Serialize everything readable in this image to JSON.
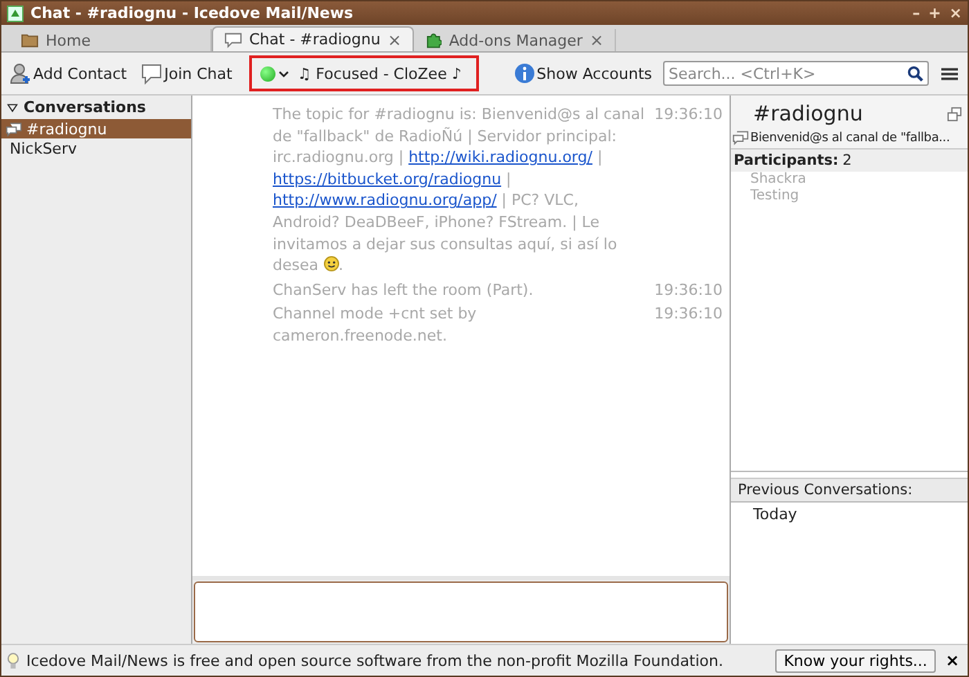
{
  "window": {
    "title": "Chat - #radiognu - Icedove Mail/News",
    "controls": [
      "–",
      "+",
      "×"
    ]
  },
  "tabs": [
    {
      "label": "Home",
      "kind": "folder",
      "selected": false
    },
    {
      "label": "Chat - #radiognu",
      "kind": "chat",
      "selected": true,
      "close": "×"
    },
    {
      "label": "Add-ons Manager",
      "kind": "addons",
      "selected": false,
      "close": "×"
    }
  ],
  "toolbar": {
    "add_contact": "Add Contact",
    "join_chat": "Join Chat",
    "status_text": "♫ Focused - CloZee ♪",
    "show_accounts": "Show Accounts",
    "search": {
      "placeholder": "Search... <Ctrl+K>"
    }
  },
  "sidebar": {
    "heading": "Conversations",
    "expanded": true,
    "items": [
      {
        "label": "#radiognu",
        "kind": "channel",
        "selected": true
      },
      {
        "label": "NickServ",
        "kind": "person",
        "selected": false
      }
    ]
  },
  "messages": [
    {
      "time": "19:36:10",
      "parts": [
        {
          "kind": "text",
          "text": "The topic for #radiognu is: Bienvenid@s al canal de \"fallback\" de RadioÑú | Servidor principal: irc.radiognu.org | "
        },
        {
          "kind": "link",
          "text": "http://wiki.radiognu.org/"
        },
        {
          "kind": "text",
          "text": " | "
        },
        {
          "kind": "link",
          "text": "https://bitbucket.org/radiognu"
        },
        {
          "kind": "text",
          "text": " | "
        },
        {
          "kind": "link",
          "text": "http://www.radiognu.org/app/"
        },
        {
          "kind": "text",
          "text": " | PC? VLC, Android? DeaDBeeF, iPhone? FStream. | Le invitamos a dejar sus consultas aquí, si así lo desea "
        },
        {
          "kind": "smiley"
        },
        {
          "kind": "text",
          "text": "."
        }
      ]
    },
    {
      "time": "19:36:10",
      "parts": [
        {
          "kind": "text",
          "text": "ChanServ has left the room (Part)."
        }
      ]
    },
    {
      "time": "19:36:10",
      "parts": [
        {
          "kind": "text",
          "text": "Channel mode +cnt set by cameron.freenode.net."
        }
      ]
    }
  ],
  "channel_panel": {
    "name": "#radiognu",
    "topic": "Bienvenid@s al canal de \"fallba...",
    "participants_label": "Participants:",
    "participants_count": "2",
    "participants": [
      "Shackra",
      "Testing"
    ],
    "previous_heading": "Previous Conversations:",
    "previous": [
      "Today"
    ]
  },
  "status_bar": {
    "text": "Icedove Mail/News is free and open source software from the non-profit Mozilla Foundation.",
    "button": "Know your rights...",
    "close": "×"
  }
}
